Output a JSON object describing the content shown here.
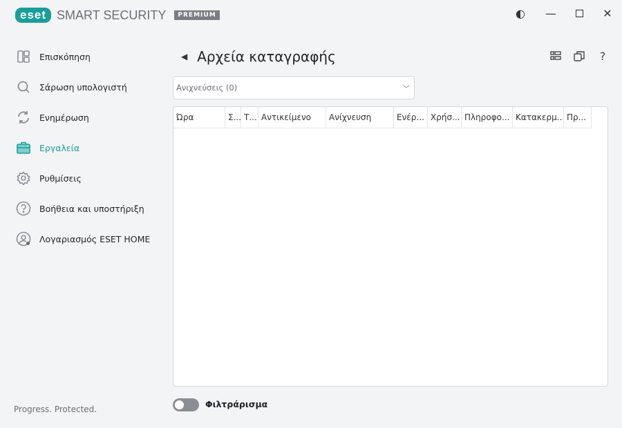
{
  "app": {
    "brand": "eset",
    "product": "SMART SECURITY",
    "edition": "PREMIUM",
    "tagline": "Progress. Protected."
  },
  "sidebar": {
    "items": [
      {
        "label": "Επισκόπηση",
        "icon": "dashboard-icon"
      },
      {
        "label": "Σάρωση υπολογιστή",
        "icon": "search-icon"
      },
      {
        "label": "Ενημέρωση",
        "icon": "refresh-icon"
      },
      {
        "label": "Εργαλεία",
        "icon": "toolbox-icon",
        "active": true
      },
      {
        "label": "Ρυθμίσεις",
        "icon": "gear-icon"
      },
      {
        "label": "Βοήθεια και υποστήριξη",
        "icon": "help-icon"
      },
      {
        "label": "Λογαριασμός ESET HOME",
        "icon": "account-icon"
      }
    ]
  },
  "main": {
    "title": "Αρχεία καταγραφής",
    "log_select": "Ανιχνεύσεις (0)",
    "columns": [
      "Ώρα",
      "Σ...",
      "Τ...",
      "Αντικείμενο",
      "Ανίχνευση",
      "Ενέρ...",
      "Χρήσ...",
      "Πληροφο...",
      "Κατακερμ...",
      "Πρ..."
    ],
    "filter_label": "Φιλτράρισμα",
    "filter_on": false
  },
  "colors": {
    "accent": "#1a9e9a"
  }
}
